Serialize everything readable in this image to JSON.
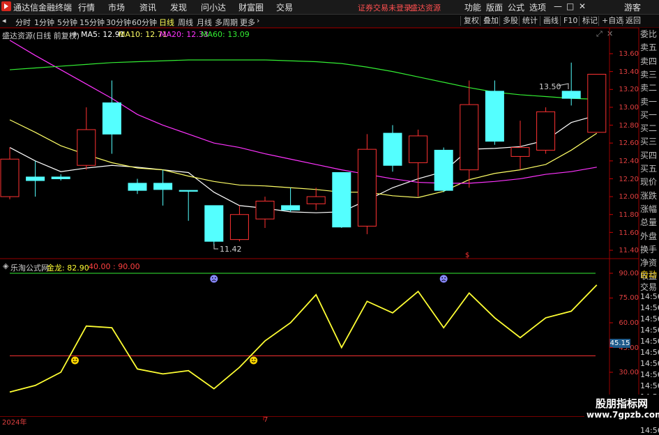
{
  "app": {
    "title": "通达信金融终端",
    "menus": [
      "行情",
      "市场",
      "资讯",
      "发现",
      "问小达",
      "财富圈",
      "交易"
    ],
    "status_left": "证券交易未登录",
    "status_right": "盛达资源",
    "right_menus": [
      "功能",
      "版面",
      "公式",
      "选项"
    ],
    "guest": "游客",
    "window_controls": [
      "—",
      "□",
      "✕"
    ]
  },
  "toolbar": {
    "periods": [
      "分时",
      "1分钟",
      "5分钟",
      "15分钟",
      "30分钟",
      "60分钟",
      "日线",
      "周线",
      "月线",
      "多周期",
      "更多"
    ],
    "active_period": "日线",
    "buttons": [
      "复权",
      "叠加",
      "多股",
      "统计",
      "画线",
      "F10",
      "标记",
      "+自选",
      "返回"
    ]
  },
  "main_chart": {
    "title": "盛达资源(日线 前复权)",
    "ma_labels": [
      {
        "label": "MA5: 12.91",
        "color": "#ffffff"
      },
      {
        "label": "MA10: 12.71",
        "color": "#ffff66"
      },
      {
        "label": "MA20: 12.33",
        "color": "#ff33ff"
      },
      {
        "label": "MA60: 13.09",
        "color": "#33ee33"
      }
    ],
    "high_label": "13.50",
    "low_label": "11.42",
    "dollar_mark": "$",
    "yticks": [
      "13.60",
      "13.40",
      "13.20",
      "13.00",
      "12.80",
      "12.60",
      "12.40",
      "12.20",
      "12.00",
      "11.80",
      "11.60",
      "11.40"
    ]
  },
  "sub_chart": {
    "title": "乐淘公式网",
    "indicator": "金龙: 82.90",
    "levels": "40.00 : 90.00",
    "yticks": [
      "90.00",
      "75.00",
      "60.00",
      "45.00",
      "30.00"
    ],
    "current_value": "45.15"
  },
  "x_axis": {
    "labels": [
      "2024年",
      "7"
    ]
  },
  "side_panel": {
    "order_book": [
      "委比",
      "卖五",
      "卖四",
      "卖三",
      "卖二",
      "卖一",
      "买一",
      "买二",
      "买三",
      "买四",
      "买五",
      "现价",
      "涨跌",
      "涨幅",
      "总量",
      "外盘",
      "换手",
      "净资",
      "收益"
    ],
    "lower_labels": [
      "自动",
      "交易"
    ],
    "times": [
      "14:56",
      "14:56",
      "14:56",
      "14:56",
      "14:56",
      "14:56",
      "14:56",
      "14:56",
      "14:56",
      "14:56",
      "14:56",
      "14:56",
      "14:56"
    ]
  },
  "watermark": {
    "line1": "股朋指标网",
    "line2": "www.7gpzb.com"
  },
  "chart_data": {
    "type": "candlestick",
    "price_range": [
      11.3,
      13.75
    ],
    "candles": [
      {
        "o": 12.0,
        "h": 12.55,
        "l": 11.97,
        "c": 12.42
      },
      {
        "o": 12.22,
        "h": 12.4,
        "l": 12.0,
        "c": 12.18
      },
      {
        "o": 12.22,
        "h": 12.25,
        "l": 12.18,
        "c": 12.2
      },
      {
        "o": 12.35,
        "h": 13.0,
        "l": 12.3,
        "c": 12.75
      },
      {
        "o": 13.05,
        "h": 13.3,
        "l": 12.48,
        "c": 12.7
      },
      {
        "o": 12.15,
        "h": 12.2,
        "l": 12.03,
        "c": 12.07
      },
      {
        "o": 12.15,
        "h": 12.3,
        "l": 11.9,
        "c": 12.08
      },
      {
        "o": 12.07,
        "h": 12.07,
        "l": 11.73,
        "c": 12.06
      },
      {
        "o": 11.9,
        "h": 11.9,
        "l": 11.45,
        "c": 11.5
      },
      {
        "o": 11.52,
        "h": 11.9,
        "l": 11.5,
        "c": 11.8
      },
      {
        "o": 11.75,
        "h": 12.0,
        "l": 11.65,
        "c": 11.95
      },
      {
        "o": 11.9,
        "h": 12.1,
        "l": 11.83,
        "c": 11.85
      },
      {
        "o": 11.92,
        "h": 12.1,
        "l": 11.85,
        "c": 12.0
      },
      {
        "o": 12.27,
        "h": 12.27,
        "l": 11.65,
        "c": 11.66
      },
      {
        "o": 11.67,
        "h": 12.7,
        "l": 11.58,
        "c": 12.53
      },
      {
        "o": 12.71,
        "h": 12.8,
        "l": 12.28,
        "c": 12.35
      },
      {
        "o": 12.38,
        "h": 12.75,
        "l": 12.0,
        "c": 12.68
      },
      {
        "o": 12.52,
        "h": 12.55,
        "l": 12.05,
        "c": 12.07
      },
      {
        "o": 12.3,
        "h": 13.3,
        "l": 12.1,
        "c": 13.03
      },
      {
        "o": 13.18,
        "h": 13.3,
        "l": 12.58,
        "c": 12.62
      },
      {
        "o": 12.45,
        "h": 12.85,
        "l": 12.3,
        "c": 12.55
      },
      {
        "o": 12.52,
        "h": 13.0,
        "l": 12.48,
        "c": 12.95
      },
      {
        "o": 13.18,
        "h": 13.5,
        "l": 13.02,
        "c": 13.1
      },
      {
        "o": 12.72,
        "h": 13.35,
        "l": 12.72,
        "c": 13.37
      }
    ],
    "ma": [
      {
        "name": "MA5",
        "color": "#ffffff",
        "values": [
          12.55,
          12.4,
          12.28,
          12.32,
          12.35,
          12.33,
          12.3,
          12.27,
          12.05,
          11.9,
          11.87,
          11.83,
          11.82,
          11.83,
          11.96,
          12.1,
          12.2,
          12.28,
          12.53,
          12.54,
          12.56,
          12.63,
          12.83,
          12.91
        ]
      },
      {
        "name": "MA10",
        "color": "#ffff66",
        "values": [
          12.86,
          12.72,
          12.57,
          12.47,
          12.38,
          12.32,
          12.3,
          12.23,
          12.17,
          12.13,
          12.12,
          12.1,
          12.08,
          12.05,
          12.05,
          12.01,
          11.99,
          12.06,
          12.19,
          12.26,
          12.3,
          12.36,
          12.52,
          12.71
        ]
      },
      {
        "name": "MA20",
        "color": "#ff33ff",
        "values": [
          13.75,
          13.58,
          13.42,
          13.26,
          13.1,
          12.92,
          12.8,
          12.7,
          12.6,
          12.55,
          12.48,
          12.42,
          12.36,
          12.3,
          12.25,
          12.2,
          12.16,
          12.15,
          12.15,
          12.17,
          12.2,
          12.25,
          12.28,
          12.33
        ]
      },
      {
        "name": "MA60",
        "color": "#33ee33",
        "values": [
          13.42,
          13.44,
          13.46,
          13.48,
          13.5,
          13.51,
          13.52,
          13.53,
          13.53,
          13.53,
          13.53,
          13.52,
          13.51,
          13.49,
          13.45,
          13.4,
          13.34,
          13.28,
          13.22,
          13.17,
          13.14,
          13.12,
          13.1,
          13.09
        ]
      }
    ],
    "indicator": {
      "name": "金龙",
      "color": "#ffff33",
      "range": [
        17,
        100
      ],
      "levels": [
        {
          "value": 40,
          "color": "#ff3333"
        },
        {
          "value": 90,
          "color": "#33ee33"
        }
      ],
      "values": [
        18,
        22,
        30,
        58,
        57,
        32,
        29,
        31,
        20,
        33,
        49,
        60,
        77,
        45,
        73,
        66,
        79,
        57,
        78,
        63,
        51,
        63,
        67,
        82.9
      ],
      "buy_signals": [
        3,
        10
      ],
      "sell_signals": [
        8,
        17
      ]
    }
  }
}
